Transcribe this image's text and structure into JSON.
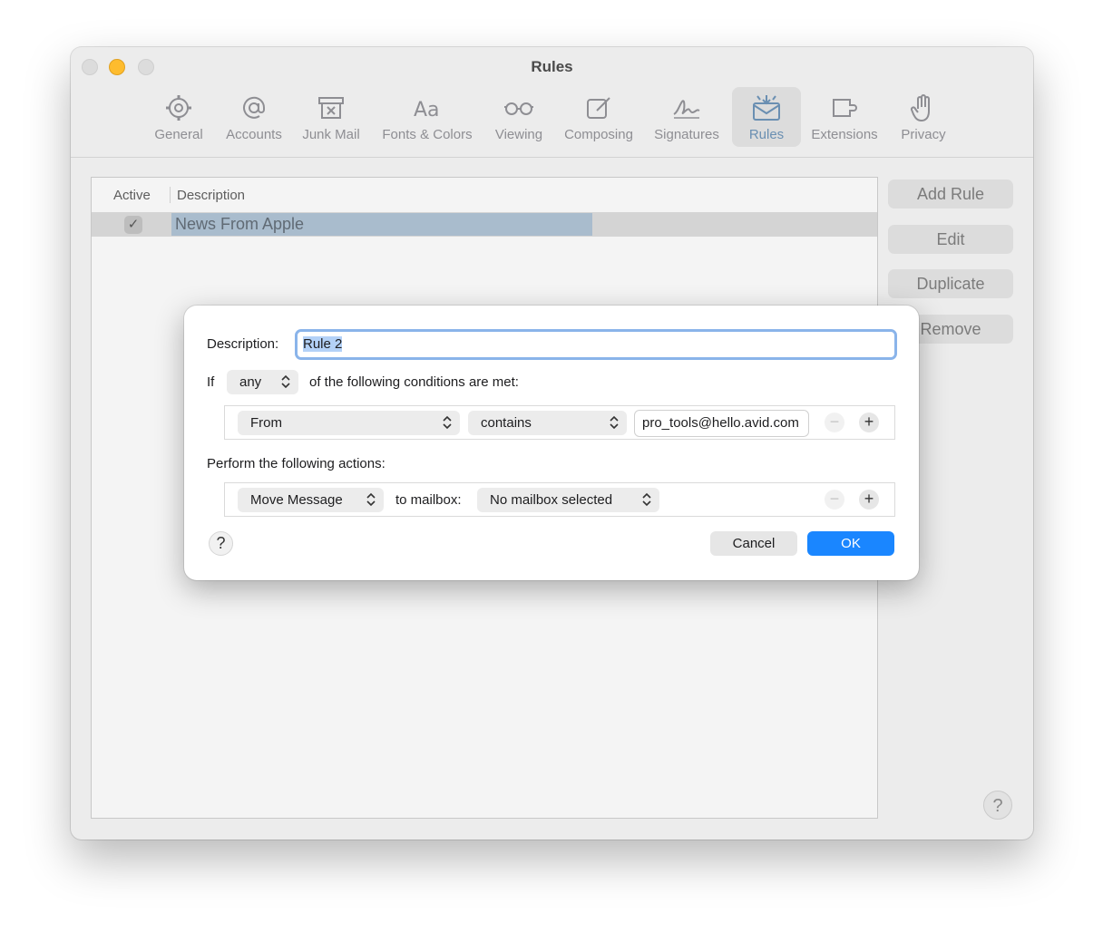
{
  "window": {
    "title": "Rules"
  },
  "toolbar": {
    "items": [
      {
        "label": "General",
        "icon": "gear-icon"
      },
      {
        "label": "Accounts",
        "icon": "at-sign-icon"
      },
      {
        "label": "Junk Mail",
        "icon": "junk-trash-icon"
      },
      {
        "label": "Fonts & Colors",
        "icon": "fonts-icon"
      },
      {
        "label": "Viewing",
        "icon": "glasses-icon"
      },
      {
        "label": "Composing",
        "icon": "compose-icon"
      },
      {
        "label": "Signatures",
        "icon": "signature-icon"
      },
      {
        "label": "Rules",
        "icon": "rules-envelope-icon",
        "selected": true
      },
      {
        "label": "Extensions",
        "icon": "extensions-icon"
      },
      {
        "label": "Privacy",
        "icon": "hand-icon"
      }
    ]
  },
  "rules_table": {
    "headers": {
      "active": "Active",
      "description": "Description"
    },
    "rows": [
      {
        "active_mark": "✓",
        "description": "News From Apple"
      }
    ]
  },
  "side_buttons": {
    "add_rule": "Add Rule",
    "edit": "Edit",
    "duplicate": "Duplicate",
    "remove": "Remove"
  },
  "corner_help": "?",
  "sheet": {
    "description_label": "Description:",
    "description_value": "Rule 2",
    "if_label": "If",
    "match_value": "any",
    "conditions_text": "of the following conditions are met:",
    "condition": {
      "field": "From",
      "operator": "contains",
      "value": "pro_tools@hello.avid.com"
    },
    "actions_label": "Perform the following actions:",
    "action": {
      "type": "Move Message",
      "to_label": "to mailbox:",
      "mailbox": "No mailbox selected"
    },
    "minus": "−",
    "plus": "+",
    "help": "?",
    "cancel": "Cancel",
    "ok": "OK"
  },
  "colors": {
    "accent": "#1a86ff",
    "focus_ring": "#8ab4ea",
    "selection": "#a9bccd"
  }
}
